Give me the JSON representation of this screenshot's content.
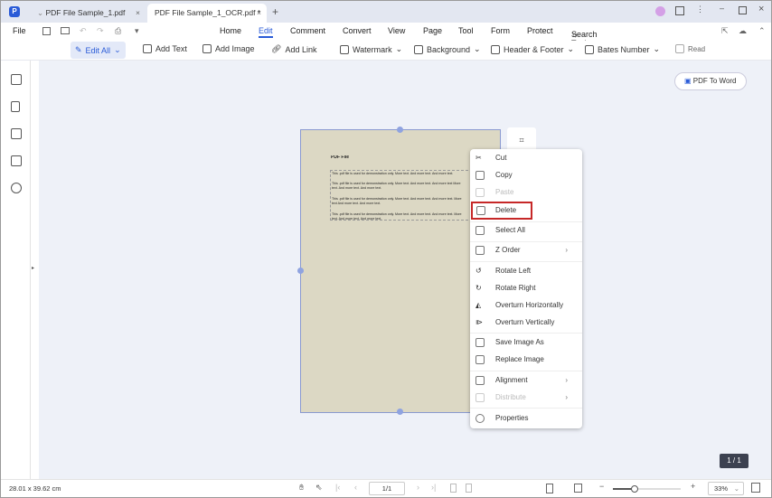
{
  "tabs": [
    {
      "label": "PDF File Sample_1.pdf"
    },
    {
      "label": "PDF File Sample_1_OCR.pdf *"
    }
  ],
  "menu": {
    "file": "File",
    "items": [
      "Home",
      "Edit",
      "Comment",
      "Convert",
      "View",
      "Page",
      "Tool",
      "Form",
      "Protect"
    ],
    "active": "Edit",
    "search_placeholder": "Search Tools"
  },
  "toolbar": {
    "edit_all": "Edit All",
    "add_text": "Add Text",
    "add_image": "Add Image",
    "add_link": "Add Link",
    "watermark": "Watermark",
    "background": "Background",
    "header_footer": "Header & Footer",
    "bates_number": "Bates Number",
    "read": "Read"
  },
  "pdf_to_word": "PDF To Word",
  "document": {
    "title": "PDF File",
    "lines": [
      "This .pdf file is used for demonstration only. More text. And more text. And more text.",
      "This .pdf file is used for demonstration only. More text. And more text. And more text More",
      "text. And more text. And more text.",
      "This .pdf file is used for demonstration only. More text. And more text. And more text. More",
      "text And more text. And more text.",
      "This .pdf file is used for demonstration only. More text. And more text. And more text. More",
      "text. And more text. And more text."
    ]
  },
  "context_menu": {
    "cut": "Cut",
    "copy": "Copy",
    "paste": "Paste",
    "delete": "Delete",
    "select_all": "Select All",
    "z_order": "Z Order",
    "rotate_left": "Rotate Left",
    "rotate_right": "Rotate Right",
    "overturn_h": "Overturn Horizontally",
    "overturn_v": "Overturn Vertically",
    "save_image_as": "Save Image As",
    "replace_image": "Replace Image",
    "alignment": "Alignment",
    "distribute": "Distribute",
    "properties": "Properties"
  },
  "page_badge": "1 / 1",
  "status": {
    "dimensions": "28.01 x 39.62 cm",
    "page_input": "1/1",
    "zoom": "33%"
  },
  "colors": {
    "accent": "#2a5bd7",
    "highlight": "#c62828",
    "page_bg": "#dcd8c4"
  }
}
